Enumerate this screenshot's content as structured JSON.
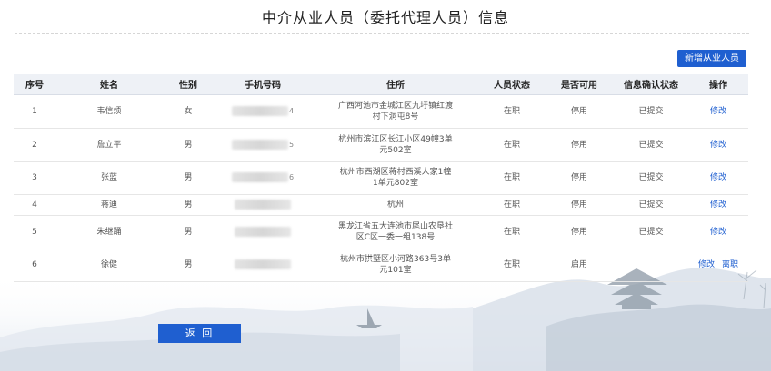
{
  "page": {
    "title": "中介从业人员（委托代理人员）信息",
    "add_button": "新增从业人员",
    "back_button": "返 回"
  },
  "table": {
    "headers": [
      "序号",
      "姓名",
      "性别",
      "手机号码",
      "住所",
      "人员状态",
      "是否可用",
      "信息确认状态",
      "操作"
    ],
    "rows": [
      {
        "no": "1",
        "name": "韦信烦",
        "gender": "女",
        "phone_tail": "4",
        "addr1": "广西河池市金城江区九圩镇红渡",
        "addr2": "村下洞屯8号",
        "status": "在职",
        "usable": "停用",
        "confirm": "已提交",
        "actions": [
          "修改"
        ]
      },
      {
        "no": "2",
        "name": "詹立平",
        "gender": "男",
        "phone_tail": "5",
        "addr1": "杭州市滨江区长江小区49幢3单",
        "addr2": "元502室",
        "status": "在职",
        "usable": "停用",
        "confirm": "已提交",
        "actions": [
          "修改"
        ]
      },
      {
        "no": "3",
        "name": "张蓝",
        "gender": "男",
        "phone_tail": "6",
        "addr1": "杭州市西湖区蒋村西溪人家1幢",
        "addr2": "1单元802室",
        "status": "在职",
        "usable": "停用",
        "confirm": "已提交",
        "actions": [
          "修改"
        ]
      },
      {
        "no": "4",
        "name": "蒋迪",
        "gender": "男",
        "phone_tail": "",
        "addr1": "杭州",
        "addr2": "",
        "status": "在职",
        "usable": "停用",
        "confirm": "已提交",
        "actions": [
          "修改"
        ]
      },
      {
        "no": "5",
        "name": "朱继踊",
        "gender": "男",
        "phone_tail": "",
        "addr1": "黑龙江省五大连池市尾山农垦社",
        "addr2": "区C区一委一组138号",
        "status": "在职",
        "usable": "停用",
        "confirm": "已提交",
        "actions": [
          "修改"
        ]
      },
      {
        "no": "6",
        "name": "徐健",
        "gender": "男",
        "phone_tail": "",
        "addr1": "杭州市拱墅区小河路363号3单",
        "addr2": "元101室",
        "status": "在职",
        "usable": "启用",
        "confirm": "",
        "actions": [
          "修改",
          "离职"
        ]
      }
    ]
  },
  "colors": {
    "accent": "#1f5fd0",
    "header_bg": "#eef1f6"
  }
}
